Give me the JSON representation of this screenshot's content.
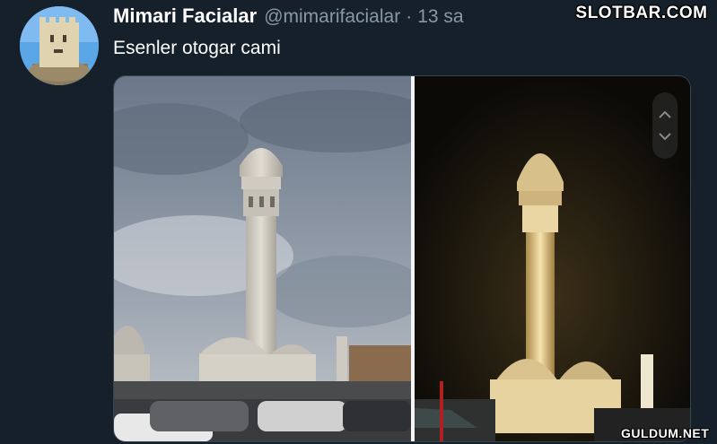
{
  "tweet": {
    "author_name": "Mimari Facialar",
    "author_handle": "@mimarifacialar",
    "separator": "·",
    "time": "13 sa",
    "text": "Esenler otogar cami"
  },
  "watermarks": {
    "top": "SLOTBAR.COM",
    "bottom": "GULDUM.NET"
  },
  "media": {
    "photos": [
      {
        "scene": "day"
      },
      {
        "scene": "night"
      }
    ],
    "scroll_icons": [
      "chevron-up-icon",
      "chevron-down-icon"
    ]
  },
  "colors": {
    "background": "#15202b",
    "secondary_text": "#8899a6",
    "primary_text": "#ffffff"
  }
}
